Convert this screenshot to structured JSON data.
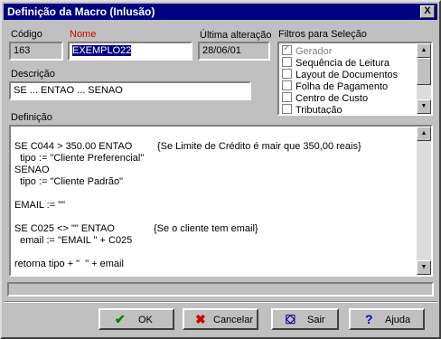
{
  "window": {
    "title": "Definição da Macro (Inlusão)",
    "close_label": "X"
  },
  "fields": {
    "codigo": {
      "label": "Código",
      "value": "163"
    },
    "nome": {
      "label": "Nome",
      "value": "EXEMPLO22"
    },
    "ultima": {
      "label": "Última alteração",
      "value": "28/06/01"
    },
    "descricao": {
      "label": "Descrição",
      "value": "SE ... ENTAO ... SENAO"
    }
  },
  "filtros": {
    "label": "Filtros para Seleção",
    "items": [
      {
        "label": "Gerador",
        "checked": true,
        "disabled": true
      },
      {
        "label": "Sequência de Leitura",
        "checked": false,
        "disabled": false
      },
      {
        "label": "Layout de Documentos",
        "checked": false,
        "disabled": false
      },
      {
        "label": "Folha de Pagamento",
        "checked": false,
        "disabled": false
      },
      {
        "label": "Centro de Custo",
        "checked": false,
        "disabled": false
      },
      {
        "label": "Tributação",
        "checked": false,
        "disabled": false
      }
    ]
  },
  "definicao": {
    "label": "Definição",
    "lines": [
      {
        "code": "SE C044 > 350.00 ENTAO",
        "comment": "{Se Limite de Crédito é mair que 350,00 reais}"
      },
      {
        "code": "  tipo := \"Cliente Preferencial\"",
        "comment": ""
      },
      {
        "code": "SENAO",
        "comment": ""
      },
      {
        "code": "  tipo := \"Cliente Padrão\"",
        "comment": ""
      },
      {
        "code": "",
        "comment": ""
      },
      {
        "code": "EMAIL := \"\"",
        "comment": ""
      },
      {
        "code": "",
        "comment": ""
      },
      {
        "code": "SE C025 <> \"\" ENTAO",
        "comment": "{Se o cliente tem email}"
      },
      {
        "code": "  email := \"EMAIL \" + C025",
        "comment": ""
      },
      {
        "code": "",
        "comment": ""
      },
      {
        "code": "retorna tipo + \"  \" + email",
        "comment": ""
      }
    ]
  },
  "buttons": {
    "ok": {
      "label": "OK",
      "icon": "check-icon",
      "color": "#008000"
    },
    "cancelar": {
      "label": "Cancelar",
      "icon": "x-icon",
      "color": "#cc0000"
    },
    "sair": {
      "label": "Sair",
      "icon": "door-icon",
      "color": "#000080"
    },
    "ajuda": {
      "label": "Ajuda",
      "icon": "question-icon",
      "color": "#0000cc"
    }
  }
}
